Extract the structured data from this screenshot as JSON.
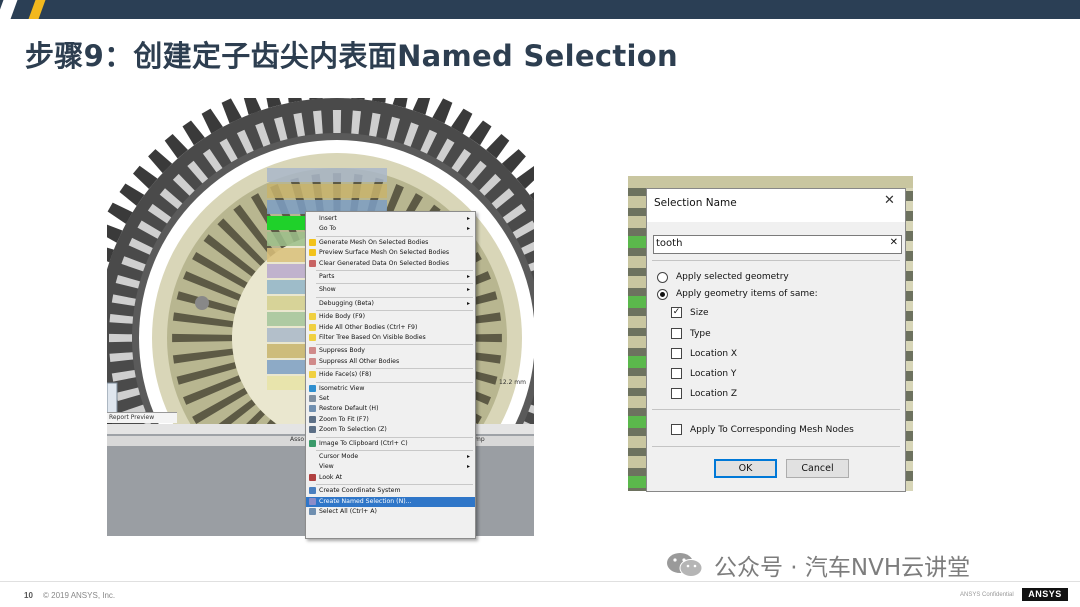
{
  "slide": {
    "title": "步骤9：创建定子齿尖内表面Named Selection",
    "page_number": "10",
    "copyright": "© 2019 ANSYS, Inc.",
    "confidential": "ANSYS Confidential",
    "logo_text": "ANSYS",
    "watermark": "公众号 · 汽车NVH云讲堂"
  },
  "left_shot": {
    "preview_tab": "Report Preview",
    "strip_left": "Asso",
    "strip_right": "mp",
    "dim_label": "12.2 mm",
    "context_menu": [
      {
        "label": "Insert",
        "submenu": true,
        "icon": ""
      },
      {
        "label": "Go To",
        "submenu": true,
        "icon": ""
      },
      {
        "sep": true
      },
      {
        "label": "Generate Mesh On Selected Bodies",
        "icon": "lightning-icon"
      },
      {
        "label": "Preview Surface Mesh On Selected Bodies",
        "icon": "lightning-icon"
      },
      {
        "label": "Clear Generated Data On Selected Bodies",
        "icon": "clear-icon"
      },
      {
        "sep": true
      },
      {
        "label": "Parts",
        "submenu": true,
        "icon": ""
      },
      {
        "sep": true
      },
      {
        "label": "Show",
        "submenu": true,
        "icon": ""
      },
      {
        "sep": true
      },
      {
        "label": "Debugging (Beta)",
        "submenu": true,
        "icon": ""
      },
      {
        "sep": true
      },
      {
        "label": "Hide Body (F9)",
        "icon": "lightbulb-icon"
      },
      {
        "label": "Hide All Other Bodies (Ctrl+ F9)",
        "icon": "lightbulb-icon"
      },
      {
        "label": "Filter Tree Based On Visible Bodies",
        "icon": "lightbulb-icon"
      },
      {
        "sep": true
      },
      {
        "label": "Suppress Body",
        "icon": "suppress-icon"
      },
      {
        "label": "Suppress All Other Bodies",
        "icon": "suppress-icon"
      },
      {
        "sep": true
      },
      {
        "label": "Hide Face(s) (F8)",
        "icon": "lightbulb-icon"
      },
      {
        "sep": true
      },
      {
        "label": "Isometric View",
        "icon": "globe-icon"
      },
      {
        "label": "Set",
        "icon": "set-icon"
      },
      {
        "label": "Restore Default (H)",
        "icon": "restore-icon"
      },
      {
        "label": "Zoom To Fit (F7)",
        "icon": "zoom-icon"
      },
      {
        "label": "Zoom To Selection (Z)",
        "icon": "zoom-icon"
      },
      {
        "sep": true
      },
      {
        "label": "Image To Clipboard (Ctrl+ C)",
        "icon": "camera-icon"
      },
      {
        "sep": true
      },
      {
        "label": "Cursor Mode",
        "submenu": true,
        "icon": ""
      },
      {
        "label": "View",
        "submenu": true,
        "icon": ""
      },
      {
        "label": "Look At",
        "icon": "look-at-icon"
      },
      {
        "sep": true
      },
      {
        "label": "Create Coordinate System",
        "icon": "axes-icon"
      },
      {
        "label": "Create Named Selection (N)...",
        "icon": "named-selection-icon",
        "highlighted": true
      },
      {
        "label": "Select All (Ctrl+ A)",
        "icon": "select-all-icon"
      }
    ]
  },
  "dialog": {
    "title": "Selection Name",
    "close_glyph": "✕",
    "name_value": "tooth",
    "clear_glyph": "✕",
    "radio_apply_selected": "Apply selected geometry",
    "radio_apply_items": "Apply geometry items of same:",
    "radio_selected": "items",
    "check_size": "Size",
    "check_type": "Type",
    "check_location_x": "Location X",
    "check_location_y": "Location Y",
    "check_location_z": "Location Z",
    "check_mesh_nodes": "Apply To Corresponding Mesh Nodes",
    "size_checked": true,
    "ok_label": "OK",
    "cancel_label": "Cancel"
  },
  "colors": {
    "title": "#2d3e50",
    "topbar": "#2b3f55",
    "accent": "#f2b81e",
    "menu_highlight": "#2f76c8",
    "selected_tooth": "#1fd12a"
  }
}
